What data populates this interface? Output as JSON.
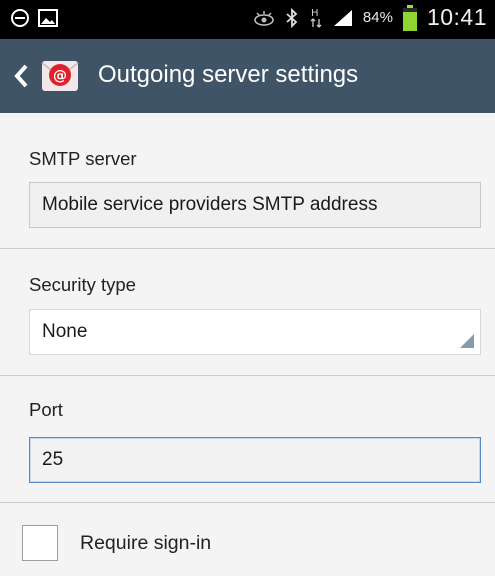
{
  "status_bar": {
    "battery_percent": "84%",
    "time": "10:41",
    "network_label": "H",
    "icons": [
      "minus-circle-icon",
      "image-icon",
      "eye-icon",
      "bluetooth-icon",
      "data-arrows-icon",
      "signal-icon",
      "battery-icon"
    ]
  },
  "action_bar": {
    "title": "Outgoing server settings",
    "back_icon": "chevron-left-icon",
    "app_icon": "email-app-icon",
    "color": "#3f5467"
  },
  "smtp": {
    "label": "SMTP server",
    "value": "Mobile service providers SMTP address"
  },
  "security": {
    "label": "Security type",
    "selected": "None"
  },
  "port": {
    "label": "Port",
    "value": "25"
  },
  "signin": {
    "label": "Require sign-in",
    "checked": false
  }
}
